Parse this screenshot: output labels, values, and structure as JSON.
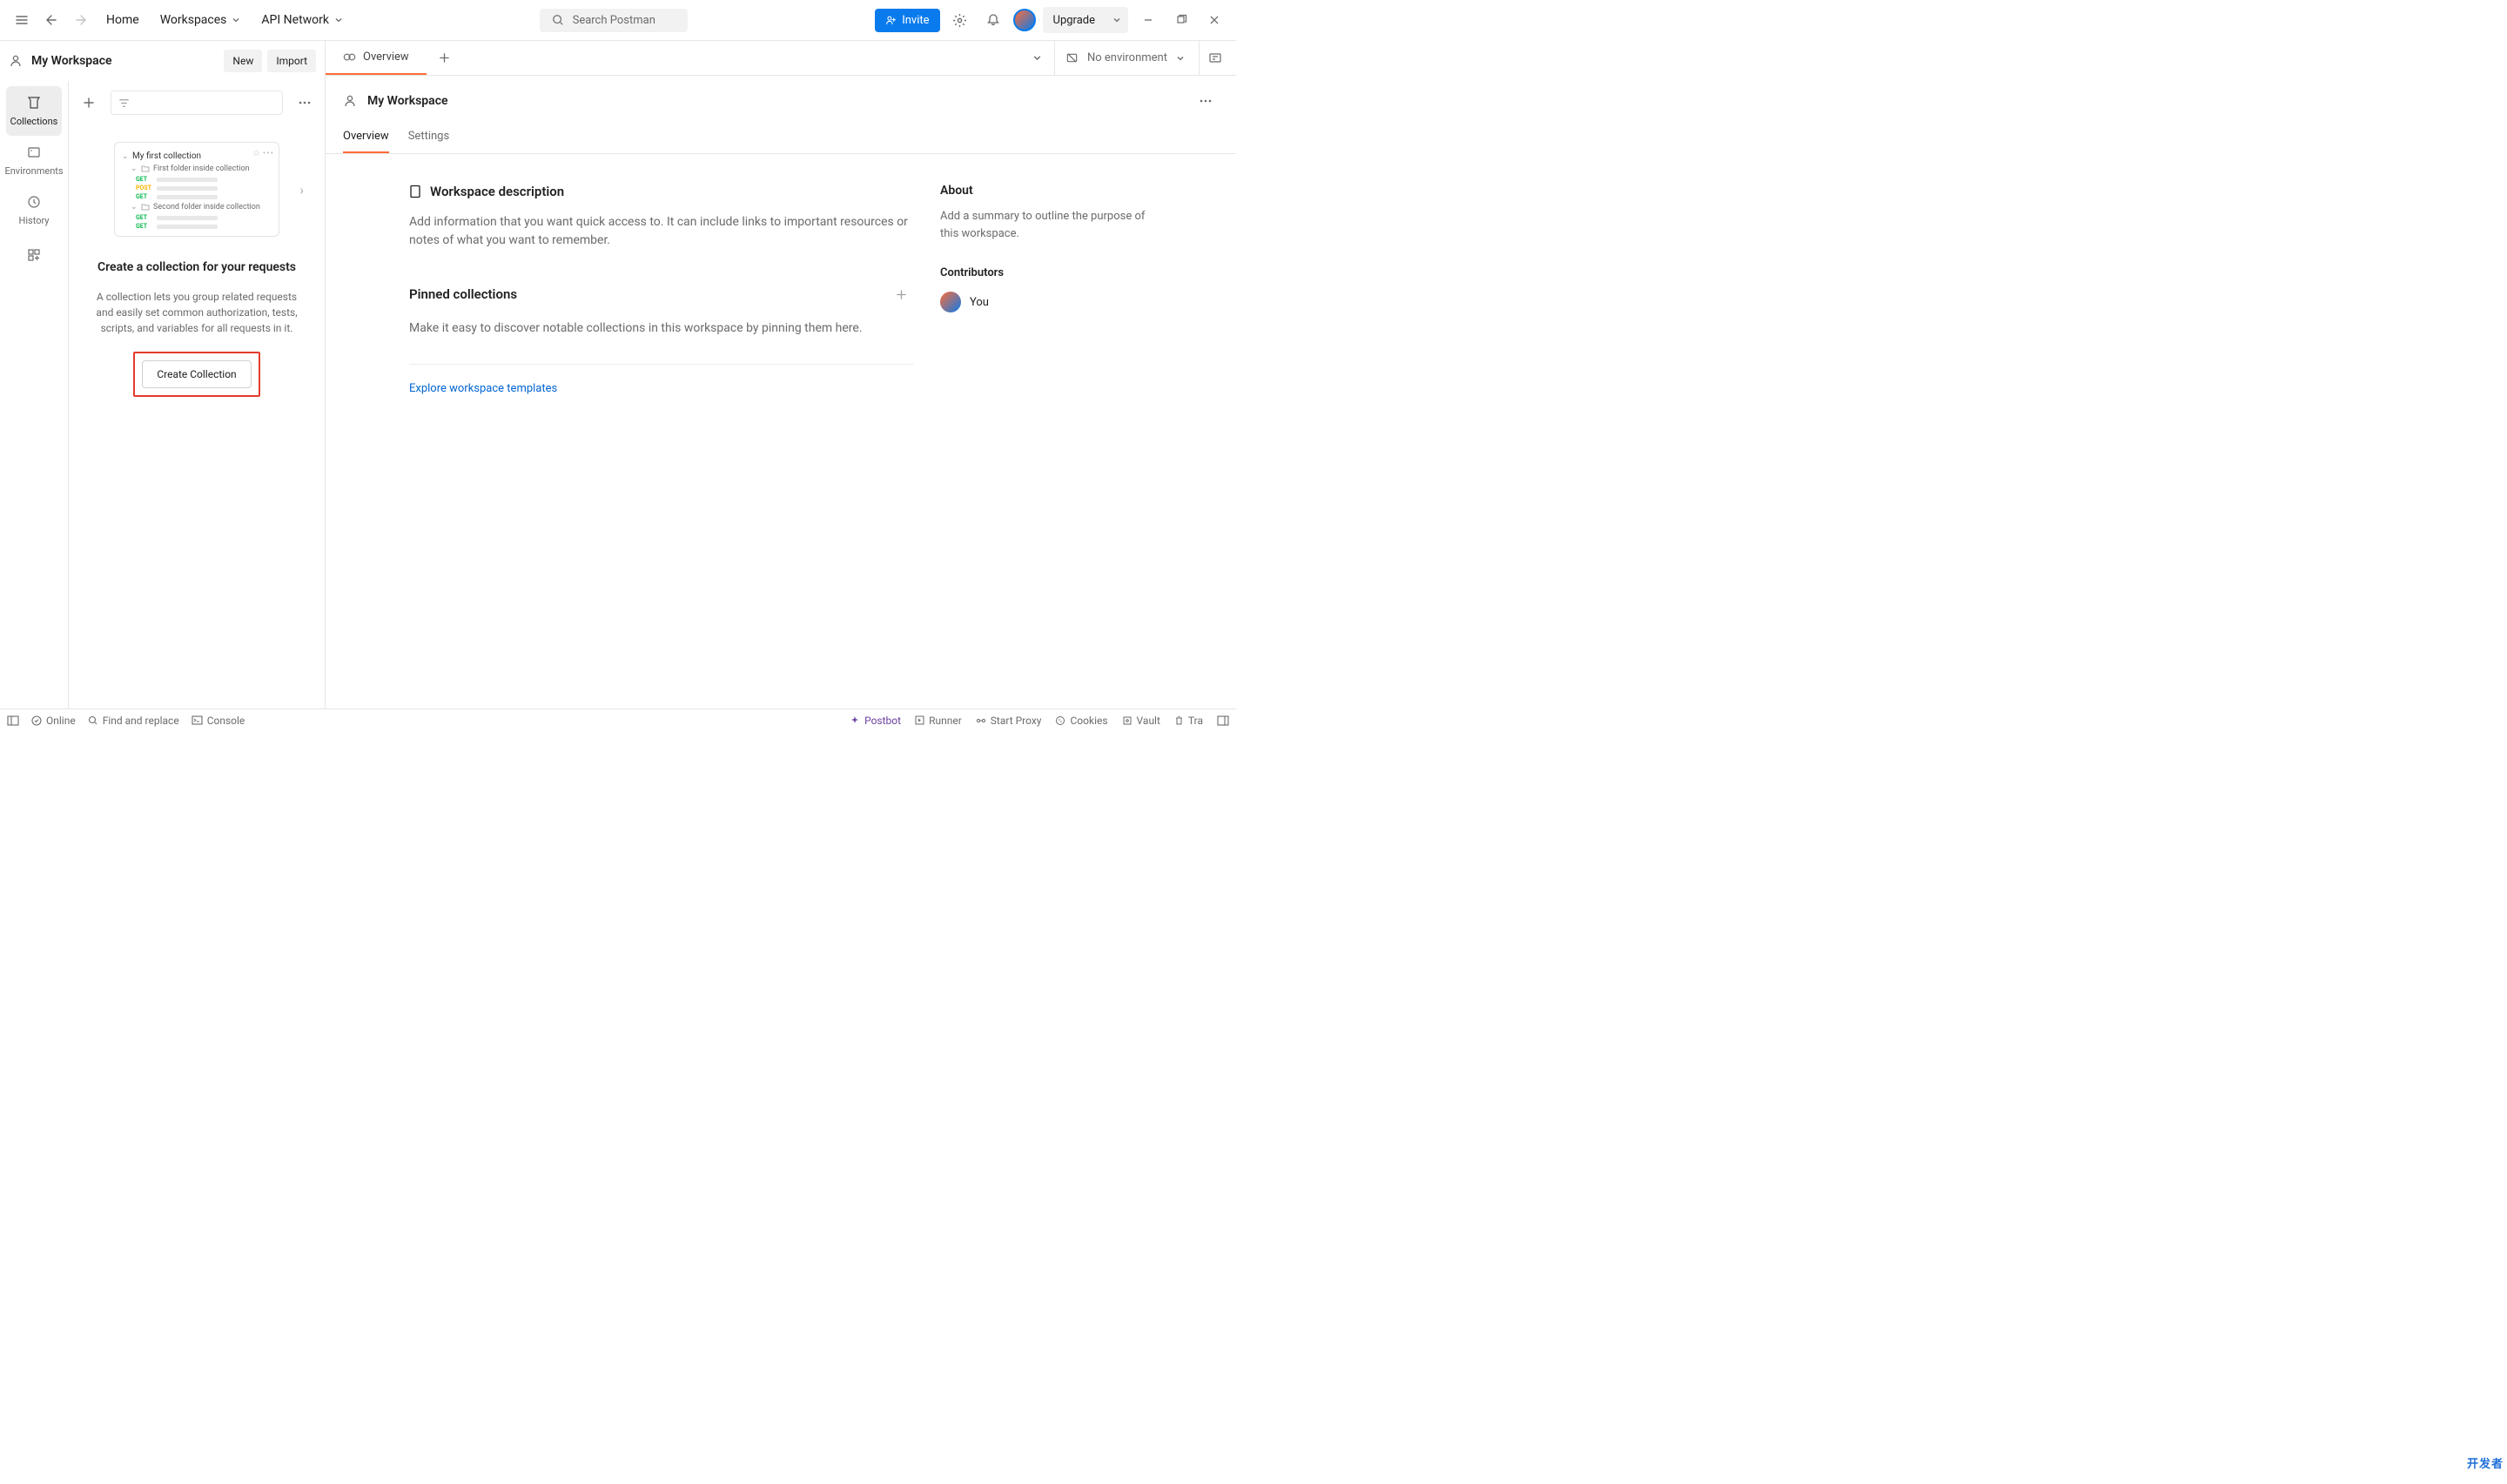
{
  "header": {
    "home": "Home",
    "workspaces": "Workspaces",
    "apiNetwork": "API Network",
    "searchPlaceholder": "Search Postman",
    "invite": "Invite",
    "upgrade": "Upgrade"
  },
  "wsBar": {
    "title": "My Workspace",
    "new": "New",
    "import": "Import"
  },
  "rail": {
    "collections": "Collections",
    "environments": "Environments",
    "history": "History"
  },
  "sidebarEmpty": {
    "illus": {
      "collection": "My first collection",
      "folder1": "First folder inside collection",
      "folder2": "Second folder inside collection",
      "get": "GET",
      "post": "POST"
    },
    "heading": "Create a collection for your requests",
    "body": "A collection lets you group related requests and easily set common authorization, tests, scripts, and variables for all requests in it.",
    "button": "Create Collection"
  },
  "tabs": {
    "overview": "Overview",
    "noEnv": "No environment"
  },
  "contentHeader": {
    "title": "My Workspace"
  },
  "subTabs": {
    "overview": "Overview",
    "settings": "Settings"
  },
  "workspace": {
    "descHeading": "Workspace description",
    "descBody": "Add information that you want quick access to. It can include links to important resources or notes of what you want to remember.",
    "pinnedHeading": "Pinned collections",
    "pinnedBody": "Make it easy to discover notable collections in this workspace by pinning them here.",
    "exploreLink": "Explore workspace templates"
  },
  "about": {
    "heading": "About",
    "body": "Add a summary to outline the purpose of this workspace.",
    "contributorsHeading": "Contributors",
    "you": "You"
  },
  "footer": {
    "online": "Online",
    "find": "Find and replace",
    "console": "Console",
    "postbot": "Postbot",
    "runner": "Runner",
    "startProxy": "Start Proxy",
    "cookies": "Cookies",
    "vault": "Vault",
    "trash": "Tra"
  },
  "watermark": "开发者"
}
